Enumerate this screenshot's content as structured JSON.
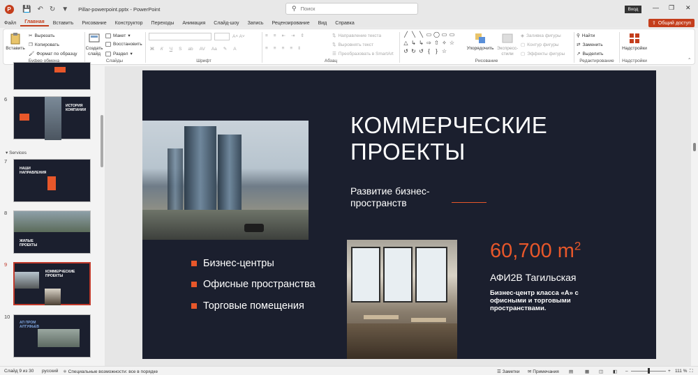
{
  "titlebar": {
    "filename": "Pillar-powerpoint.pptx",
    "separator": "-",
    "app": "PowerPoint",
    "search_placeholder": "Поиск",
    "login": "Вход",
    "share": "Общий доступ"
  },
  "menu": [
    "Файл",
    "Главная",
    "Вставить",
    "Рисование",
    "Конструктор",
    "Переходы",
    "Анимация",
    "Слайд-шоу",
    "Запись",
    "Рецензирование",
    "Вид",
    "Справка"
  ],
  "menu_active": "Главная",
  "ribbon": {
    "clipboard": {
      "paste": "Вставить",
      "cut": "Вырезать",
      "copy": "Копировать",
      "format": "Формат по образцу",
      "label": "Буфер обмена"
    },
    "slides": {
      "new": "Создать",
      "new2": "слайд",
      "layout": "Макет",
      "reset": "Восстановить",
      "section": "Раздел",
      "label": "Слайды"
    },
    "font": {
      "bold": "Ж",
      "italic": "К",
      "underline": "Ч",
      "strike": "S",
      "label": "Шрифт"
    },
    "paragraph": {
      "direction": "Направление текста",
      "align": "Выровнять текст",
      "smartart": "Преобразовать в SmartArt",
      "label": "Абзац"
    },
    "drawing": {
      "arrange": "Упорядочить",
      "styles": "Экспресс-",
      "styles2": "стили",
      "fill": "Заливка фигуры",
      "outline": "Контур фигуры",
      "effects": "Эффекты фигуры",
      "label": "Рисование"
    },
    "editing": {
      "find": "Найти",
      "replace": "Заменить",
      "select": "Выделить",
      "label": "Редактирование"
    },
    "addins": {
      "button": "Надстройки",
      "label": "Надстройки"
    }
  },
  "thumbnails": [
    {
      "num": "6",
      "title": "ИСТОРИЯ КОМПАНИИ"
    },
    {
      "section": "Services"
    },
    {
      "num": "7",
      "title": "НАШИ НАПРАВЛЕНИЯ"
    },
    {
      "num": "8",
      "title": "ЖИЛЫЕ ПРОЕКТЫ"
    },
    {
      "num": "9",
      "title": "КОММЕРЧЕСКИЕ ПРОЕКТЫ",
      "selected": true
    },
    {
      "num": "10",
      "title": "АП ПРОМ АЛТУФЬЕВ"
    }
  ],
  "slide": {
    "title_line1": "КОММЕРЧЕСКИЕ",
    "title_line2": "ПРОЕКТЫ",
    "subtitle_line1": "Развитие бизнес-",
    "subtitle_line2": "пространств",
    "bullets": [
      "Бизнес-центры",
      "Офисные пространства",
      "Торговые помещения"
    ],
    "metric": "60,700 m",
    "metric_sup": "2",
    "building": "АФИ2В Тагильская",
    "description": "Бизнес-центр класса «А» с офисными и торговыми пространствами.",
    "accent_color": "#e8572a",
    "background_color": "#1b1f2e"
  },
  "statusbar": {
    "slide_of": "Слайд 9 из 30",
    "language": "русский",
    "accessibility": "Специальные возможности: все в порядке",
    "notes": "Заметки",
    "comments": "Примечания",
    "zoom": "111 %"
  }
}
